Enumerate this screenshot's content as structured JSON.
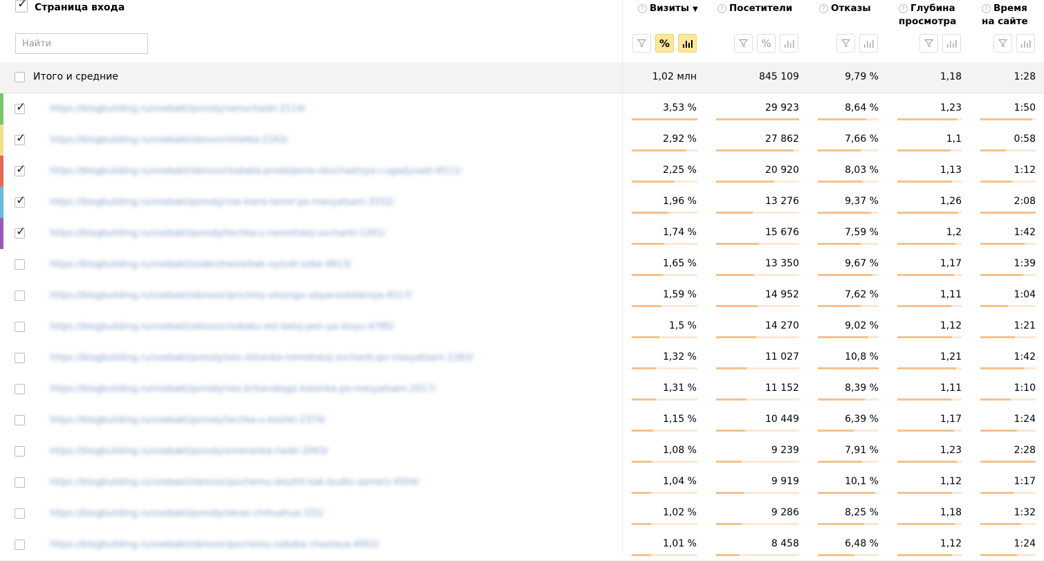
{
  "header": {
    "title": "Страница входа",
    "search_placeholder": "Найти",
    "columns": [
      {
        "key": "visits",
        "label": "Визиты",
        "sort": "▼"
      },
      {
        "key": "visitors",
        "label": "Посетители"
      },
      {
        "key": "bounces",
        "label": "Отказы"
      },
      {
        "key": "depth",
        "label_line1": "Глубина",
        "label_line2": "просмотра"
      },
      {
        "key": "time",
        "label_line1": "Время",
        "label_line2": "на сайте"
      }
    ],
    "help_glyph": "?",
    "percent_glyph": "%"
  },
  "totals": {
    "label": "Итого и средние",
    "visits": "1,02 млн",
    "visitors": "845 109",
    "bounces": "9,79 %",
    "depth": "1,18",
    "time": "1:28"
  },
  "colors": {
    "accent_button": "#fde89a",
    "bar_fill": "#f5c189",
    "bar_track": "#fbe8d6",
    "row_stripes": [
      "#7cc46c",
      "#f3df86",
      "#e06a52",
      "#69b8df",
      "#9a5ab7"
    ]
  },
  "rows": [
    {
      "url": "https://blogbuilding.ru/vsebakt/porody/venuchaski-2114/",
      "checked": true,
      "visits": "3,53 %",
      "visitors": "29 923",
      "bounces": "8,64 %",
      "depth": "1,23",
      "time": "1:50",
      "bars": {
        "visits": 1.0,
        "visitors": 1.0,
        "bounces": 0.8,
        "depth": 0.93,
        "time": 0.93
      }
    },
    {
      "url": "https://blogbuilding.ru/vsebakt/obrovor/shetka-2162/",
      "checked": true,
      "visits": "2,92 %",
      "visitors": "27 862",
      "bounces": "7,66 %",
      "depth": "1,1",
      "time": "0:58",
      "bars": {
        "visits": 0.83,
        "visitors": 0.93,
        "bounces": 0.71,
        "depth": 0.83,
        "time": 0.46
      }
    },
    {
      "url": "https://blogbuilding.ru/vsebakt/obrovor/sobaka-prodoljenie-obuchaetsya-i-ugadyvaet-4511/",
      "checked": true,
      "visits": "2,25 %",
      "visitors": "20 920",
      "bounces": "8,03 %",
      "depth": "1,13",
      "time": "1:12",
      "bars": {
        "visits": 0.64,
        "visitors": 0.7,
        "bounces": 0.74,
        "depth": 0.85,
        "time": 0.57
      }
    },
    {
      "url": "https://blogbuilding.ru/vsebakt/porody/vse-kiera-terrer-po-mesyatsam-3332/",
      "checked": true,
      "visits": "1,96 %",
      "visitors": "13 276",
      "bounces": "9,37 %",
      "depth": "1,26",
      "time": "2:08",
      "bars": {
        "visits": 0.56,
        "visitors": 0.44,
        "bounces": 0.87,
        "depth": 0.95,
        "time": 1.0
      }
    },
    {
      "url": "https://blogbuilding.ru/vsebakt/porody/techka-u-nemetskoj-ovcharki-1261/",
      "checked": true,
      "visits": "1,74 %",
      "visitors": "15 676",
      "bounces": "7,59 %",
      "depth": "1,2",
      "time": "1:42",
      "bars": {
        "visits": 0.49,
        "visitors": 0.52,
        "bounces": 0.7,
        "depth": 0.9,
        "time": 0.8
      }
    },
    {
      "url": "https://blogbuilding.ru/vsebakt/soderzhanie/kak-vyzvat-sobe-4613/",
      "checked": false,
      "visits": "1,65 %",
      "visitors": "13 350",
      "bounces": "9,67 %",
      "depth": "1,17",
      "time": "1:39",
      "bars": {
        "visits": 0.47,
        "visitors": 0.45,
        "bounces": 0.9,
        "depth": 0.88,
        "time": 0.78
      }
    },
    {
      "url": "https://blogbuilding.ru/vsebakt/obrovor/prichiny-uhorogo-obyanosteleniya-4517/",
      "checked": false,
      "visits": "1,59 %",
      "visitors": "14 952",
      "bounces": "7,62 %",
      "depth": "1,11",
      "time": "1:04",
      "bars": {
        "visits": 0.45,
        "visitors": 0.5,
        "bounces": 0.7,
        "depth": 0.84,
        "time": 0.5
      }
    },
    {
      "url": "https://blogbuilding.ru/vsebakt/obrovor/sobaku-est-beloj-pen-ya-stoyu-4785/",
      "checked": false,
      "visits": "1,5 %",
      "visitors": "14 270",
      "bounces": "9,02 %",
      "depth": "1,12",
      "time": "1:21",
      "bars": {
        "visits": 0.42,
        "visitors": 0.48,
        "bounces": 0.83,
        "depth": 0.85,
        "time": 0.63
      }
    },
    {
      "url": "https://blogbuilding.ru/vsebakt/porody/ves-shhenka-nemetskoj-ovcharki-po-mesyatsam-1283/",
      "checked": false,
      "visits": "1,32 %",
      "visitors": "11 027",
      "bounces": "10,8 %",
      "depth": "1,21",
      "time": "1:42",
      "bars": {
        "visits": 0.37,
        "visitors": 0.37,
        "bounces": 1.0,
        "depth": 0.91,
        "time": 0.8
      }
    },
    {
      "url": "https://blogbuilding.ru/vsebakt/porody/ves-britanskogo-kotenka-po-mesyatsam-2017/",
      "checked": false,
      "visits": "1,31 %",
      "visitors": "11 152",
      "bounces": "8,39 %",
      "depth": "1,11",
      "time": "1:10",
      "bars": {
        "visits": 0.37,
        "visitors": 0.37,
        "bounces": 0.77,
        "depth": 0.84,
        "time": 0.55
      }
    },
    {
      "url": "https://blogbuilding.ru/vsebakt/porody/techka-u-koshki-2374/",
      "checked": false,
      "visits": "1,15 %",
      "visitors": "10 449",
      "bounces": "6,39 %",
      "depth": "1,17",
      "time": "1:24",
      "bars": {
        "visits": 0.33,
        "visitors": 0.35,
        "bounces": 0.59,
        "depth": 0.88,
        "time": 0.66
      }
    },
    {
      "url": "https://blogbuilding.ru/vsebakt/porody/smenenka-haski-2063/",
      "checked": false,
      "visits": "1,08 %",
      "visitors": "9 239",
      "bounces": "7,91 %",
      "depth": "1,23",
      "time": "2:28",
      "bars": {
        "visits": 0.31,
        "visitors": 0.31,
        "bounces": 0.73,
        "depth": 0.93,
        "time": 1.0
      }
    },
    {
      "url": "https://blogbuilding.ru/vsebakt/obrovor/pochemu-drozhit-kak-budto-zamerz-4504/",
      "checked": false,
      "visits": "1,04 %",
      "visitors": "9 919",
      "bounces": "10,1 %",
      "depth": "1,12",
      "time": "1:17",
      "bars": {
        "visits": 0.29,
        "visitors": 0.33,
        "bounces": 0.93,
        "depth": 0.85,
        "time": 0.6
      }
    },
    {
      "url": "https://blogbuilding.ru/vsebakt/porody/okras-chihuahua-331/",
      "checked": false,
      "visits": "1,02 %",
      "visitors": "9 286",
      "bounces": "8,25 %",
      "depth": "1,18",
      "time": "1:32",
      "bars": {
        "visits": 0.29,
        "visitors": 0.31,
        "bounces": 0.76,
        "depth": 0.89,
        "time": 0.72
      }
    },
    {
      "url": "https://blogbuilding.ru/vsebakt/obrovor/pochemu-sobaka-chastaya-4952/",
      "checked": false,
      "visits": "1,01 %",
      "visitors": "8 458",
      "bounces": "6,48 %",
      "depth": "1,12",
      "time": "1:24",
      "bars": {
        "visits": 0.29,
        "visitors": 0.28,
        "bounces": 0.6,
        "depth": 0.85,
        "time": 0.66
      }
    }
  ]
}
